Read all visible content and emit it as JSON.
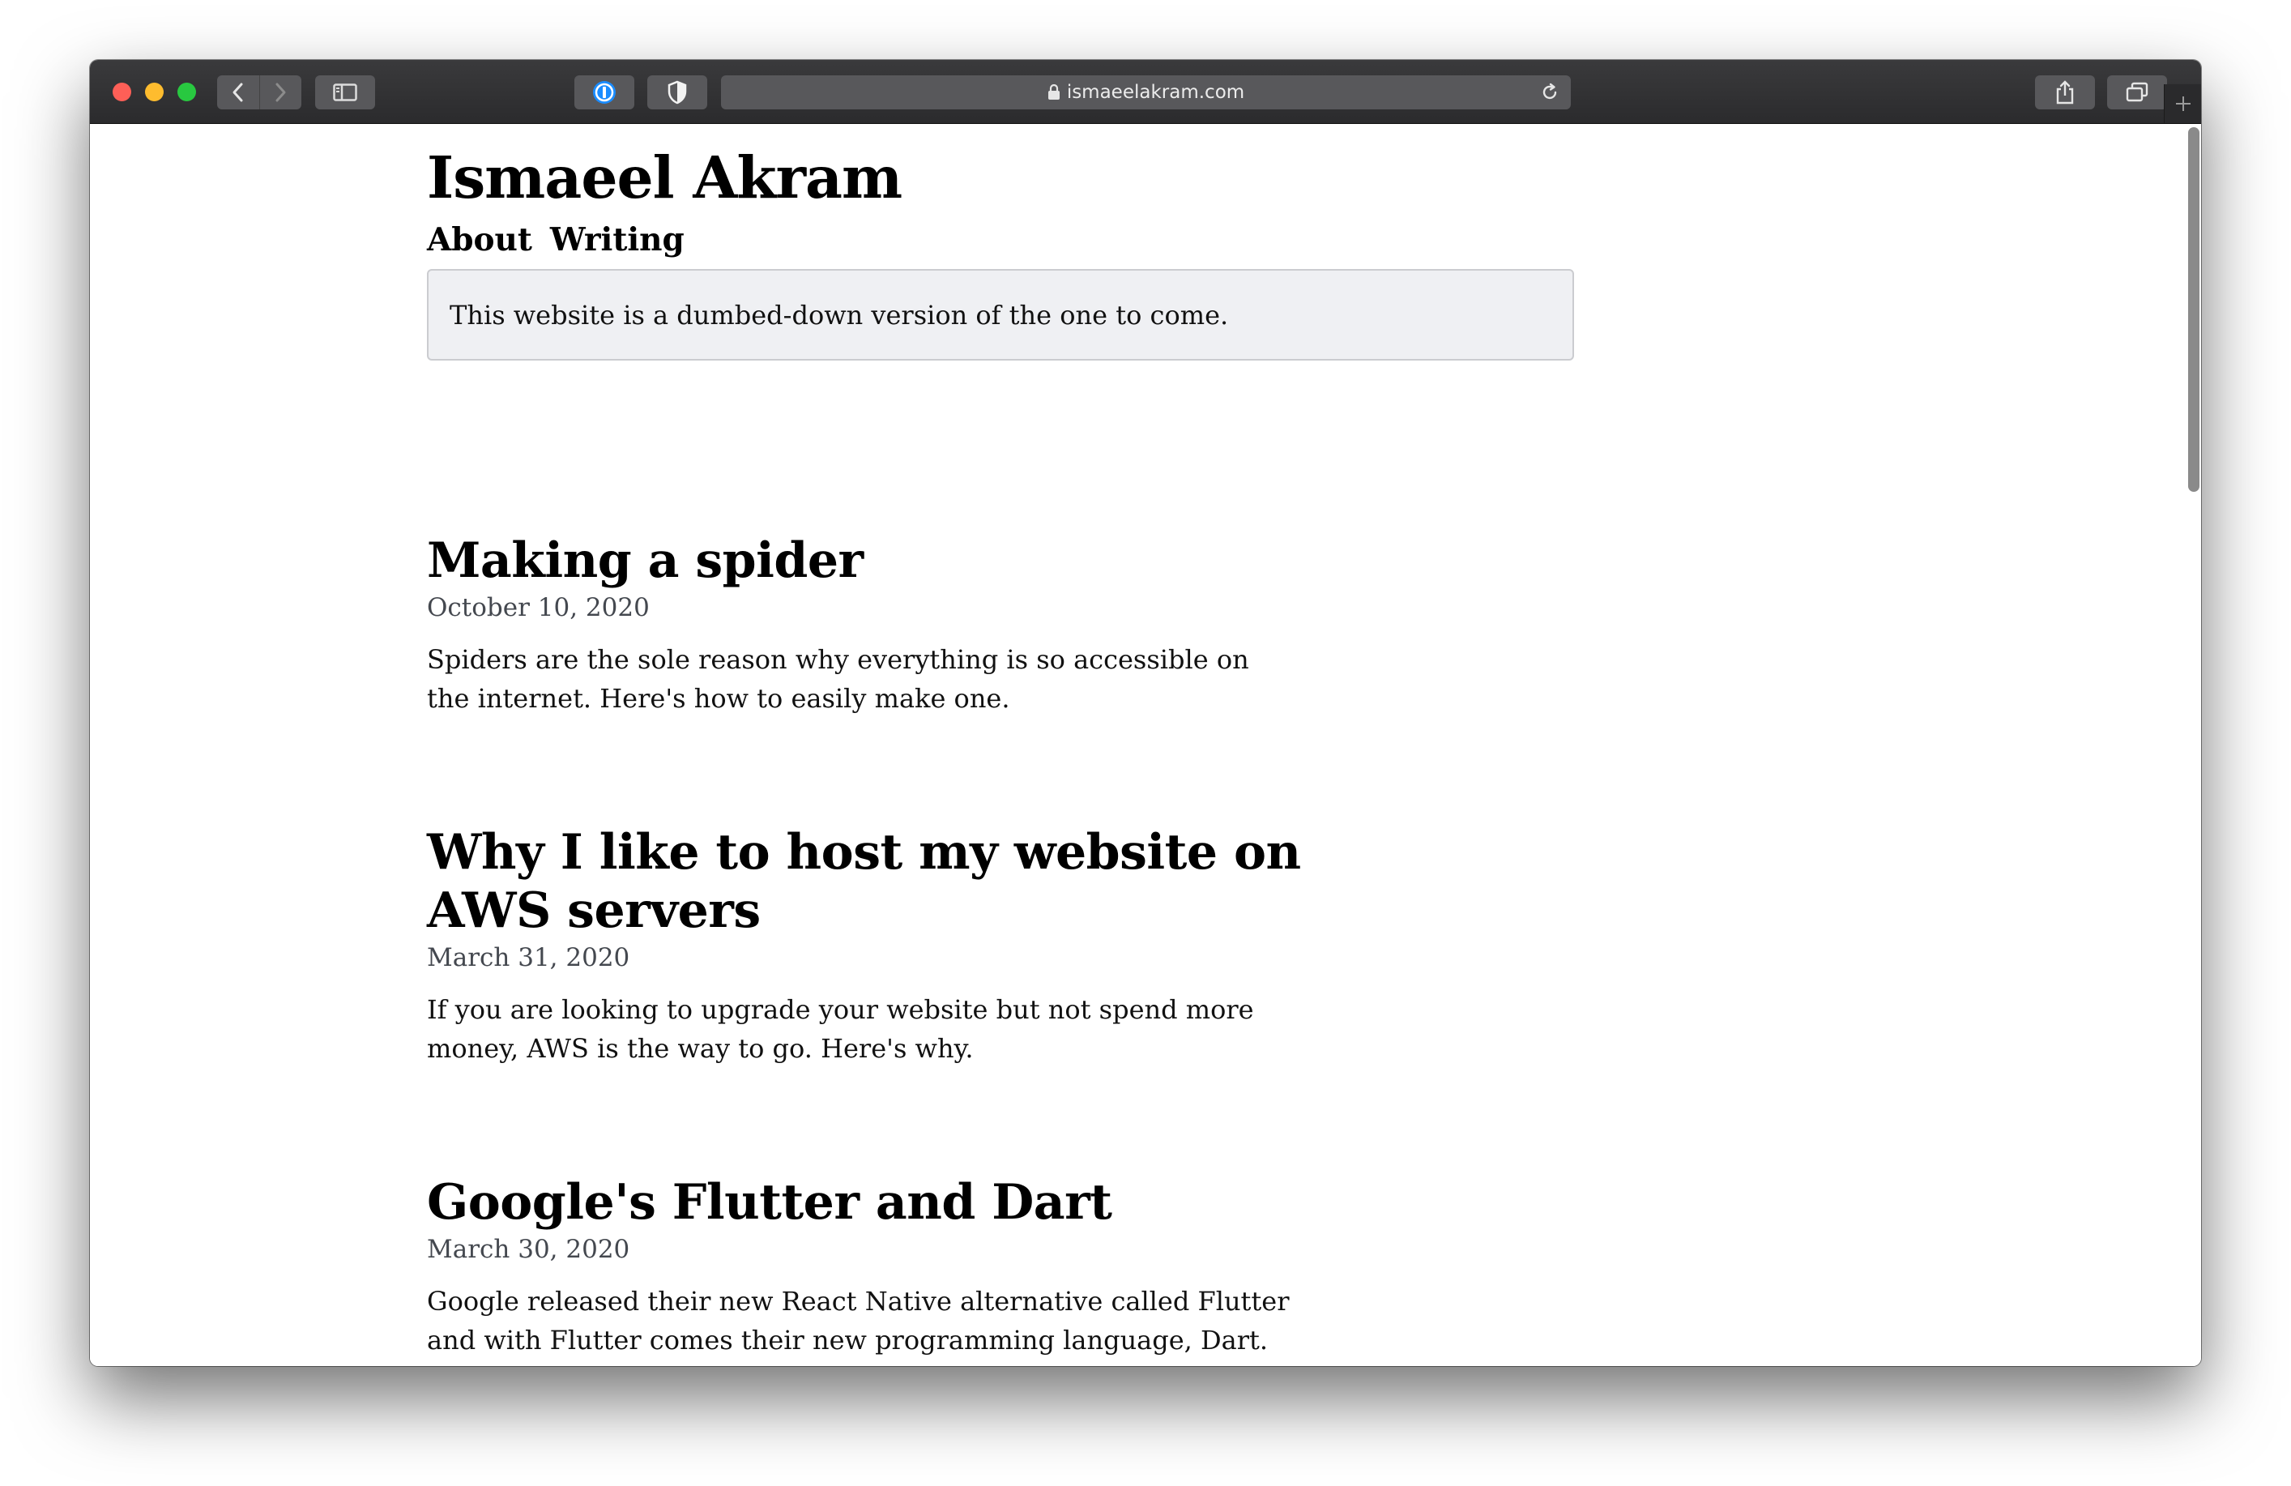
{
  "browser": {
    "url": "ismaeelakram.com"
  },
  "site": {
    "title": "Ismaeel Akram",
    "nav": [
      "About",
      "Writing"
    ],
    "notice": "This website is a dumbed-down version of the one to come."
  },
  "posts": [
    {
      "title": "Making a spider",
      "date": "October 10, 2020",
      "excerpt": "Spiders are the sole reason why everything is so accessible on the internet. Here's how to easily make one."
    },
    {
      "title": "Why I like to host my website on AWS servers",
      "date": "March 31, 2020",
      "excerpt": "If you are looking to upgrade your website but not spend more money, AWS is the way to go. Here's why."
    },
    {
      "title": "Google's Flutter and Dart",
      "date": "March 30, 2020",
      "excerpt": "Google released their new React Native alternative called Flutter and with Flutter comes their new programming language, Dart."
    }
  ],
  "colors": {
    "titlebar": "#2b2b2d",
    "notice_bg": "#eff0f3",
    "date_text": "#44484f"
  }
}
